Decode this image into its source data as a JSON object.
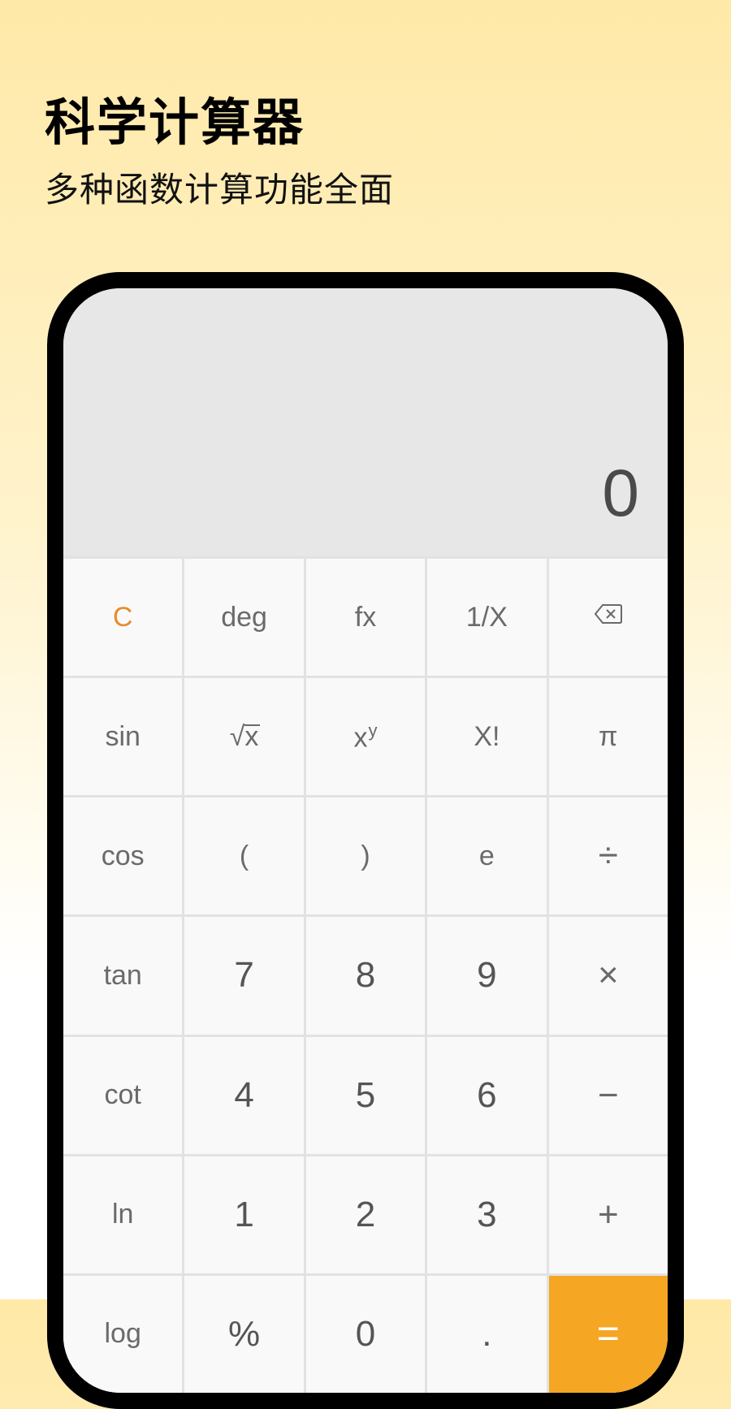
{
  "header": {
    "title": "科学计算器",
    "subtitle": "多种函数计算功能全面"
  },
  "calculator": {
    "display_value": "0",
    "keys": {
      "r1c1": "C",
      "r1c2": "deg",
      "r1c3": "fx",
      "r1c4": "1/X",
      "r1c5_icon": "backspace-icon",
      "r2c1": "sin",
      "r2c2_sym": "√",
      "r2c2_inner": "x",
      "r2c3_base": "x",
      "r2c3_sup": "y",
      "r2c4": "X!",
      "r2c5": "π",
      "r3c1": "cos",
      "r3c2": "(",
      "r3c3": ")",
      "r3c4": "e",
      "r3c5": "÷",
      "r4c1": "tan",
      "r4c2": "7",
      "r4c3": "8",
      "r4c4": "9",
      "r4c5": "×",
      "r5c1": "cot",
      "r5c2": "4",
      "r5c3": "5",
      "r5c4": "6",
      "r5c5": "−",
      "r6c1": "ln",
      "r6c2": "1",
      "r6c3": "2",
      "r6c4": "3",
      "r6c5": "+",
      "r7c1": "log",
      "r7c2": "%",
      "r7c3": "0",
      "r7c4": ".",
      "r7c5": "="
    }
  }
}
